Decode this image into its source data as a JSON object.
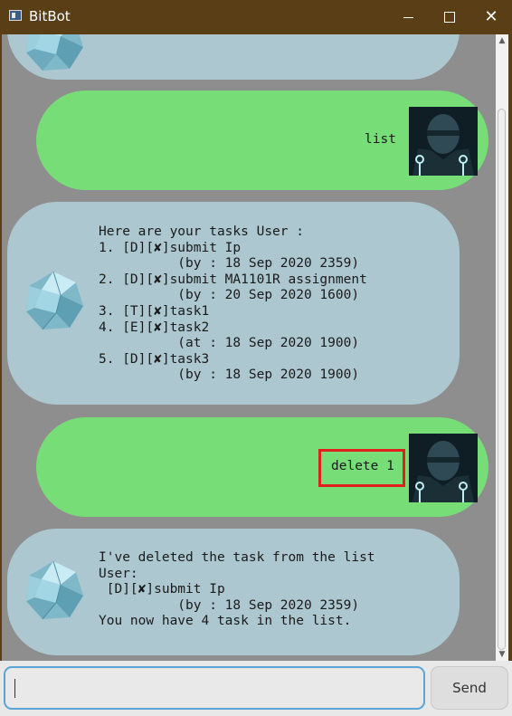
{
  "window": {
    "title": "BitBot",
    "minimize_icon": "minimize-icon",
    "maximize_icon": "maximize-icon",
    "close_icon": "close-icon"
  },
  "colors": {
    "titlebar": "#5a3e15",
    "chat_bg": "#8e8e8e",
    "bot_bubble": "#adc7d0",
    "user_bubble": "#77dd77",
    "highlight": "#e0201c",
    "input_border": "#5aa5d6"
  },
  "messages": [
    {
      "sender": "bot",
      "partial": true,
      "text": ""
    },
    {
      "sender": "user",
      "text": "list"
    },
    {
      "sender": "bot",
      "lines": [
        "Here are your tasks User :",
        "1. [D][✘]submit Ip",
        "          (by : 18 Sep 2020 2359)",
        "2. [D][✘]submit MA1101R assignment",
        "          (by : 20 Sep 2020 1600)",
        "3. [T][✘]task1",
        "4. [E][✘]task2",
        "          (at : 18 Sep 2020 1900)",
        "5. [D][✘]task3",
        "          (by : 18 Sep 2020 1900)"
      ]
    },
    {
      "sender": "user",
      "text": "delete 1",
      "highlighted": true
    },
    {
      "sender": "bot",
      "lines": [
        "I've deleted the task from the list",
        "User:",
        " [D][✘]submit Ip",
        "          (by : 18 Sep 2020 2359)",
        "You now have 4 task in the list."
      ]
    }
  ],
  "input": {
    "value": "",
    "placeholder": ""
  },
  "send_button": {
    "label": "Send"
  }
}
